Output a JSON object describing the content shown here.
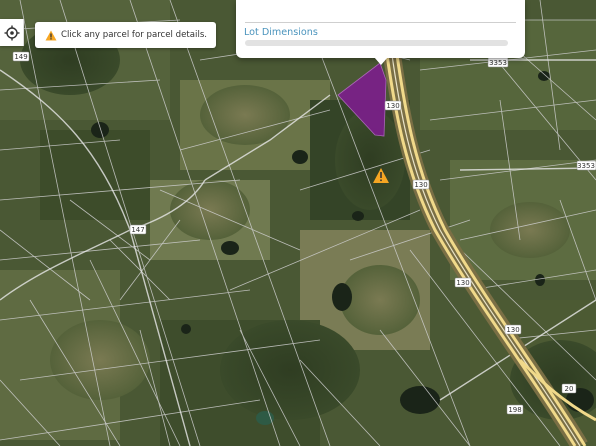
{
  "map": {
    "road_labels": {
      "r149": "149",
      "r147": "147",
      "r130a": "130",
      "r130b": "130",
      "r130c": "130",
      "r130d": "130",
      "r3353a": "3353",
      "r3353b": "3353",
      "r198": "198",
      "r20": "20"
    },
    "colors": {
      "selected_parcel": "#7b1f8a",
      "parcel_lines": "#d9d9d9",
      "highway": "#f2d98a"
    }
  },
  "hint": {
    "text": "Click any parcel for parcel details."
  },
  "popup": {
    "section_label": "Lot Dimensions"
  },
  "icons": {
    "locate": "crosshair-locate-icon",
    "warning": "warning-icon"
  }
}
